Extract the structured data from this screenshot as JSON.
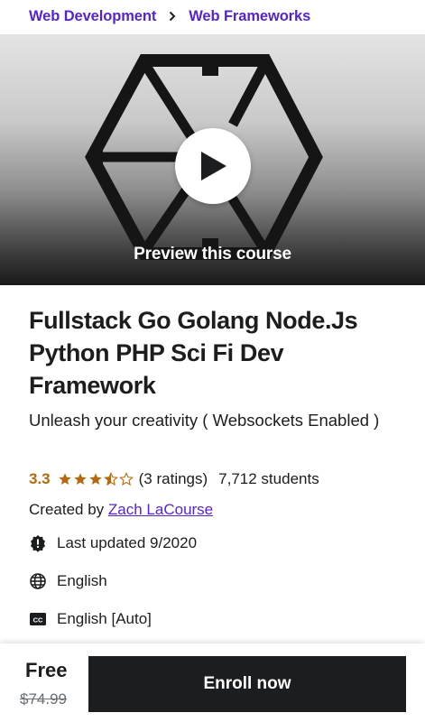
{
  "breadcrumb": {
    "items": [
      "Web Development",
      "Web Frameworks"
    ]
  },
  "preview": {
    "label": "Preview this course"
  },
  "course": {
    "title": "Fullstack Go Golang Node.Js Python PHP Sci Fi Dev Framework",
    "subtitle": "Unleash your creativity ( Websockets Enabled )",
    "rating": "3.3",
    "rating_value": 3.5,
    "ratings_count": "(3 ratings)",
    "students": "7,712 students",
    "created_by_label": "Created by",
    "instructor": "Zach LaCourse",
    "last_updated": "Last updated 9/2020",
    "language": "English",
    "captions": "English [Auto]"
  },
  "icons": {
    "breadcrumb_separator": "chevron-right-icon",
    "play": "play-icon",
    "last_updated": "alert-badge-icon",
    "language": "globe-icon",
    "captions": "closed-captions-icon"
  },
  "footer": {
    "price": "Free",
    "original_price": "$74.99",
    "enroll_label": "Enroll now"
  },
  "colors": {
    "link": "#5624d0",
    "rating": "#b4690e",
    "text": "#1c1d1f",
    "button": "#1c1d1f",
    "muted": "#6a6f73"
  }
}
